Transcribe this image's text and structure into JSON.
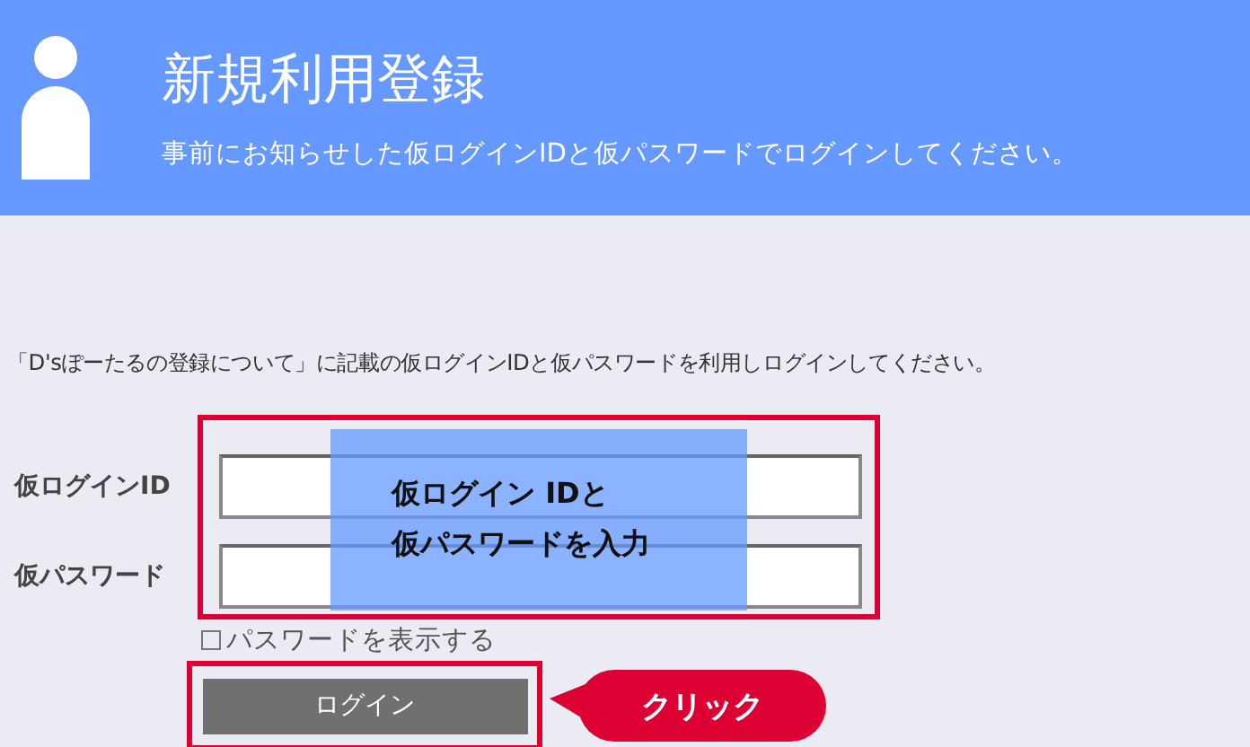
{
  "header": {
    "title": "新規利用登録",
    "subtitle": "事前にお知らせした仮ログインIDと仮パスワードでログインしてください。"
  },
  "instruction": "「D'sぽーたるの登録について」に記載の仮ログインIDと仮パスワードを利用しログインしてください。",
  "fields": [
    {
      "label": "仮ログインID"
    },
    {
      "label": "仮パスワード"
    }
  ],
  "show_password": {
    "label": "パスワードを表示する",
    "checked": false
  },
  "login_button": "ログイン",
  "overlay_note": {
    "lines": [
      "仮ログイン IDと",
      "仮パスワードを入力"
    ]
  },
  "callout": "クリック"
}
